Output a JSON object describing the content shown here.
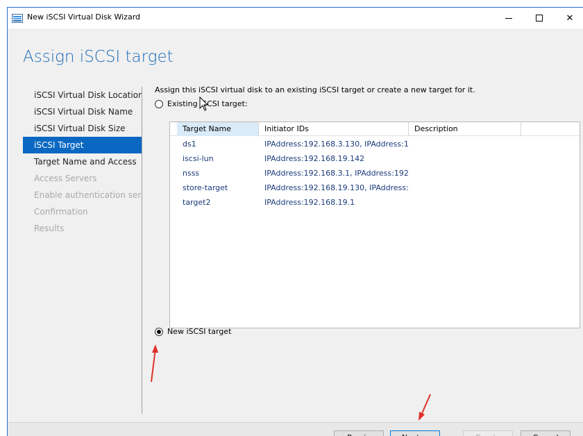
{
  "window": {
    "title": "New iSCSI Virtual Disk Wizard",
    "minimize_label": "",
    "maximize_label": "",
    "close_label": "✕"
  },
  "page": {
    "heading": "Assign iSCSI target",
    "instruction": "Assign this iSCSI virtual disk to an existing iSCSI target or create a new target for it.",
    "option_existing": "Existing iSCSI target:",
    "option_new": "New iSCSI target",
    "selected_option": "new"
  },
  "nav": {
    "items": [
      {
        "label": "iSCSI Virtual Disk Location",
        "state": "normal"
      },
      {
        "label": "iSCSI Virtual Disk Name",
        "state": "normal"
      },
      {
        "label": "iSCSI Virtual Disk Size",
        "state": "normal"
      },
      {
        "label": "iSCSI Target",
        "state": "active"
      },
      {
        "label": "Target Name and Access",
        "state": "normal"
      },
      {
        "label": "Access Servers",
        "state": "disabled"
      },
      {
        "label": "Enable authentication ser...",
        "state": "disabled"
      },
      {
        "label": "Confirmation",
        "state": "disabled"
      },
      {
        "label": "Results",
        "state": "disabled"
      }
    ]
  },
  "targets_table": {
    "columns": [
      "Target Name",
      "Initiator IDs",
      "Description",
      ""
    ],
    "sorted_column": "Target Name",
    "rows": [
      {
        "name": "ds1",
        "initiators": "IPAddress:192.168.3.130, IPAddress:1..."
      },
      {
        "name": "iscsi-lun",
        "initiators": "IPAddress:192.168.19.142"
      },
      {
        "name": "nsss",
        "initiators": "IPAddress:192.168.3.1, IPAddress:192..."
      },
      {
        "name": "store-target",
        "initiators": "IPAddress:192.168.19.130, IPAddress:..."
      },
      {
        "name": "target2",
        "initiators": "IPAddress:192.168.19.1"
      }
    ]
  },
  "buttons": {
    "previous": "< Previous",
    "next": "Next >",
    "create": "Create",
    "cancel": "Cancel"
  },
  "colors": {
    "accent": "#0a68c2",
    "heading": "#1e6bb8",
    "annotation_arrow": "#e0302a"
  },
  "icons": {
    "app": "server-manager-icon",
    "cursor": "mouse-pointer-icon",
    "annotation": "red-arrow-icon"
  }
}
